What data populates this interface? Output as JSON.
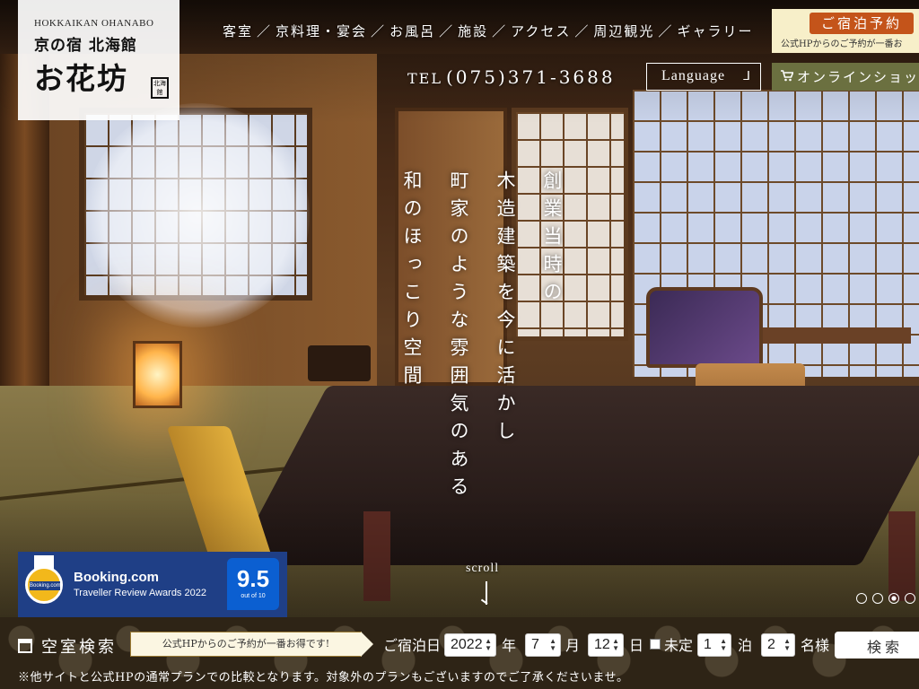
{
  "logo": {
    "roman": "HOKKAIKAN OHANABO",
    "sub": "京の宿 北海館",
    "main": "お花坊",
    "seal": "北海館"
  },
  "nav": {
    "items": [
      "客室",
      "京料理・宴会",
      "お風呂",
      "施設",
      "アクセス",
      "周辺観光",
      "ギャラリー"
    ],
    "separator": "／"
  },
  "reserve": {
    "button_label": "ご宿泊予約",
    "note": "公式HPからのご予約が一番お"
  },
  "contact": {
    "tel_label": "TEL",
    "tel_number": "(075)371-3688"
  },
  "language": {
    "label": "Language",
    "caret": "⅃"
  },
  "shop": {
    "label": "オンラインショップ",
    "icon": "cart-icon"
  },
  "tagline": {
    "lines": [
      "創業当時の",
      "木造建築を今に活かし",
      "町家のような雰囲気のある",
      "和のほっこり空間"
    ]
  },
  "booking": {
    "brand": "Booking.com",
    "award": "Traveller Review Awards 2022",
    "medal_text": "Booking.com",
    "score": "9.5",
    "out_of": "out of 10"
  },
  "scroll": {
    "label": "scroll"
  },
  "slider": {
    "count": 4,
    "active_index": 2
  },
  "search": {
    "title": "空室検索",
    "promo": "公式HPからのご予約が一番お得です!",
    "date_label": "ご宿泊日",
    "year": "2022",
    "year_unit": "年",
    "month": "7",
    "month_unit": "月",
    "day": "12",
    "day_unit": "日",
    "undecided_label": "未定",
    "nights": "1",
    "nights_unit": "泊",
    "guests": "2",
    "guests_unit": "名様",
    "submit_label": "検索",
    "disclaimer": "※他サイトと公式HPの通常プランでの比較となります。対象外のプランもございますのでご了承くださいませ。"
  },
  "colors": {
    "reserve_button": "#c4541a",
    "shop_bg": "#6b7040",
    "booking_bg": "#1f3f86",
    "score_bg": "#0b5fd1",
    "search_bg": "#2e2416"
  }
}
